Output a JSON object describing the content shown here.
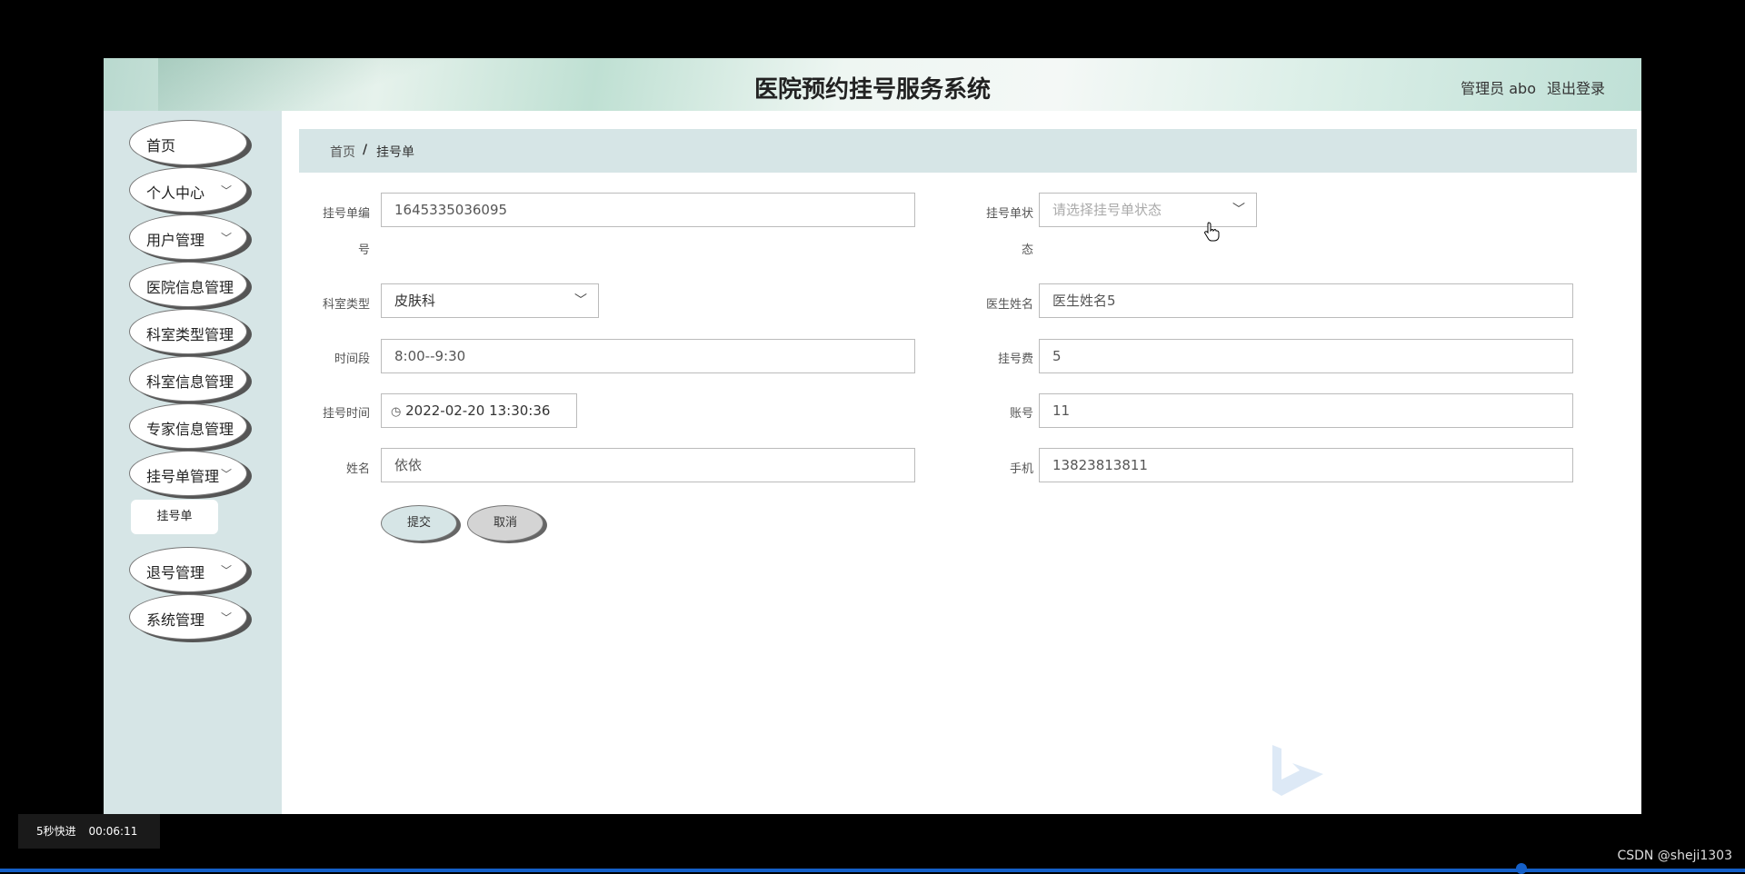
{
  "app": {
    "title": "医院预约挂号服务系统",
    "user": "管理员 abo",
    "logout": "退出登录"
  },
  "sidebar": {
    "items": [
      {
        "label": "首页",
        "has_arrow": false
      },
      {
        "label": "个人中心",
        "has_arrow": true
      },
      {
        "label": "用户管理",
        "has_arrow": true
      },
      {
        "label": "医院信息管理",
        "has_arrow": false
      },
      {
        "label": "科室类型管理",
        "has_arrow": false
      },
      {
        "label": "科室信息管理",
        "has_arrow": false
      },
      {
        "label": "专家信息管理",
        "has_arrow": false
      },
      {
        "label": "挂号单管理",
        "has_arrow": true
      },
      {
        "label": "退号管理",
        "has_arrow": true
      },
      {
        "label": "系统管理",
        "has_arrow": true
      }
    ],
    "sub_item": "挂号单"
  },
  "breadcrumb": {
    "home": "首页",
    "separator": "/",
    "current": "挂号单"
  },
  "form": {
    "order_no_label_1": "挂号单编",
    "order_no_label_2": "号",
    "order_no": "1645335036095",
    "status_label_1": "挂号单状",
    "status_label_2": "态",
    "status_placeholder": "请选择挂号单状态",
    "dept_type_label": "科室类型",
    "dept_type": "皮肤科",
    "doctor_label": "医生姓名",
    "doctor": "医生姓名5",
    "time_slot_label": "时间段",
    "time_slot": "8:00--9:30",
    "fee_label": "挂号费",
    "fee": "5",
    "reg_time_label": "挂号时间",
    "reg_time": "2022-02-20 13:30:36",
    "account_label": "账号",
    "account": "11",
    "name_label": "姓名",
    "name": "依依",
    "phone_label": "手机",
    "phone": "13823813811",
    "submit": "提交",
    "cancel": "取消"
  },
  "player": {
    "speed": "5秒快进",
    "time": "00:06:11",
    "credit": "CSDN @sheji1303",
    "progress": 0.872
  },
  "colors": {
    "sidebar_bg": "#d6e5e6",
    "submit_bg": "#d6e5e6",
    "cancel_bg": "#d4d4d4",
    "progress": "#1560c8"
  }
}
